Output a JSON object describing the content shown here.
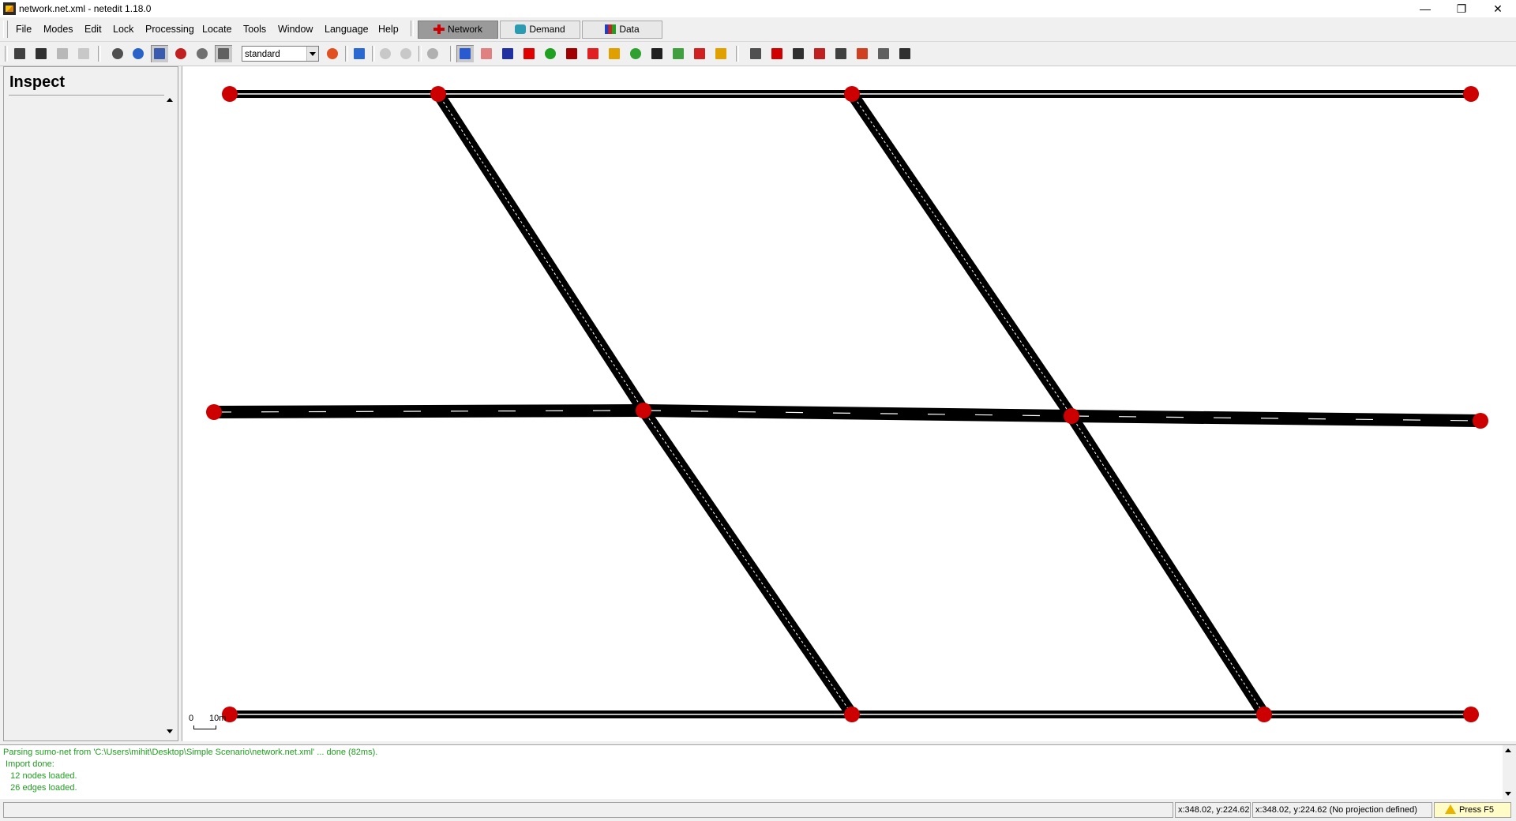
{
  "window": {
    "title": "network.net.xml - netedit 1.18.0"
  },
  "menubar": {
    "items": [
      "File",
      "Modes",
      "Edit",
      "Lock",
      "Processing",
      "Locate",
      "Tools",
      "Window",
      "Language",
      "Help"
    ],
    "modes": [
      "Network",
      "Demand",
      "Data"
    ],
    "active_mode": "Network"
  },
  "toolbar": {
    "scheme_value": "standard",
    "icons": [
      "save-network-icon",
      "save-all-icon",
      "save-as-icon",
      "save-additionals-icon",
      "move-view-icon",
      "zoom-icon",
      "select-icon",
      "locate-icon",
      "edit-viewport-icon",
      "show-grid-icon",
      "color-wheel-icon",
      "screenshot-icon",
      "undo-icon",
      "redo-icon",
      "reload-icon",
      "inspect-mode-icon",
      "delete-mode-icon",
      "select-mode-icon",
      "move-mode-icon",
      "create-edge-icon",
      "connection-mode-icon",
      "prohibition-mode-icon",
      "crossing-mode-icon",
      "traffic-light-icon",
      "additional-mode-icon",
      "wire-mode-icon",
      "taz-mode-icon",
      "shape-mode-icon",
      "decal-mode-icon",
      "grid-icon",
      "junction-icon",
      "vehicle-icon",
      "vehicle-stop-icon",
      "route-icon",
      "flow-icon",
      "edge-data-icon",
      "taz-data-icon"
    ]
  },
  "inspect": {
    "title": "Inspect"
  },
  "canvas": {
    "scale_zero": "0",
    "scale_ten": "10m"
  },
  "messages": {
    "lines": [
      "Parsing sumo-net from 'C:\\Users\\mihit\\Desktop\\Simple Scenario\\network.net.xml' ... done (82ms).",
      " Import done:",
      "   12 nodes loaded.",
      "   26 edges loaded."
    ]
  },
  "status": {
    "cursor": "x:348.02, y:224.62",
    "cursor_geo": "x:348.02, y:224.62 (No projection defined)",
    "hint": "Press F5"
  },
  "colors": {
    "road": "#000000",
    "junction": "#cc0000",
    "log_text": "#1f9c1f"
  }
}
